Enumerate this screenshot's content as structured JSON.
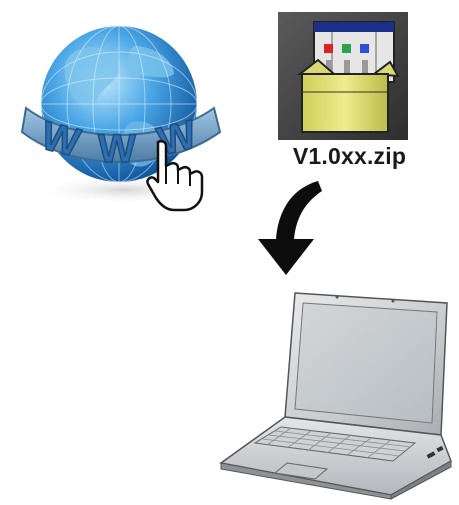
{
  "globe": {
    "label": "WWW",
    "letters": [
      "W",
      "W",
      "W"
    ]
  },
  "archive": {
    "file_name": "V1.0xx.zip",
    "icon": "zip-archive-icon"
  },
  "arrow": {
    "icon": "curved-down-arrow-icon"
  },
  "device": {
    "icon": "laptop-icon"
  },
  "colors": {
    "globe_blue": "#1f7fd1",
    "globe_light": "#8fd0f5",
    "archive_box": "#e3e27b",
    "archive_bg": "#4a4a4a",
    "text": "#1a1a1a",
    "laptop_silver": "#c9cdd0"
  }
}
